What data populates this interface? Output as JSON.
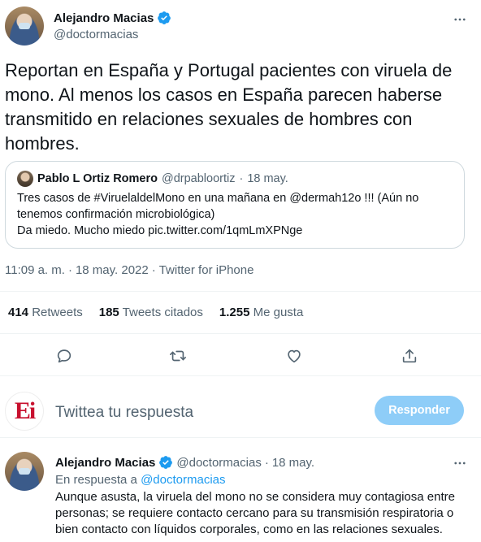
{
  "main_tweet": {
    "author_name": "Alejandro Macias",
    "author_handle": "@doctormacias",
    "text": "Reportan en España y Portugal pacientes con viruela de mono. Al menos los casos en España parecen haberse transmitido en relaciones sexuales de hombres con hombres.",
    "quote": {
      "author_name": "Pablo L Ortiz Romero",
      "author_handle": "@drpabloortiz",
      "separator": "·",
      "date": "18 may.",
      "text": "Tres casos de #ViruelaldelMono en una mañana en @dermah12o !!! (Aún no tenemos confirmación microbiológica)\nDa miedo. Mucho miedo pic.twitter.com/1qmLmXPNge"
    },
    "time": "11:09 a. m.",
    "date": "18 may. 2022",
    "separator": "·",
    "source": "Twitter for iPhone",
    "stats": {
      "retweets_count": "414",
      "retweets_label": "Retweets",
      "quotes_count": "185",
      "quotes_label": "Tweets citados",
      "likes_count": "1.255",
      "likes_label": "Me gusta"
    }
  },
  "icons": {
    "more": "more-icon",
    "reply": "reply-icon",
    "retweet": "retweet-icon",
    "like": "heart-icon",
    "share": "share-icon",
    "verified": "verified-badge-icon"
  },
  "compose": {
    "logo_text": "Ei",
    "placeholder": "Twittea tu respuesta",
    "button_label": "Responder"
  },
  "reply_tweet": {
    "author_name": "Alejandro Macias",
    "author_handle": "@doctormacias",
    "separator": "·",
    "date": "18 may.",
    "reply_to_prefix": "En respuesta a",
    "reply_to_handle": "@doctormacias",
    "text": "Aunque asusta, la viruela del mono no se considera muy contagiosa entre personas; se requiere contacto cercano para su transmisión respiratoria o bien contacto con líquidos corporales, como en las relaciones sexuales."
  },
  "colors": {
    "accent": "#1d9bf0",
    "button_disabled": "#8ecdf8",
    "muted": "#536471",
    "text": "#0f1419",
    "border": "#cfd9de"
  }
}
